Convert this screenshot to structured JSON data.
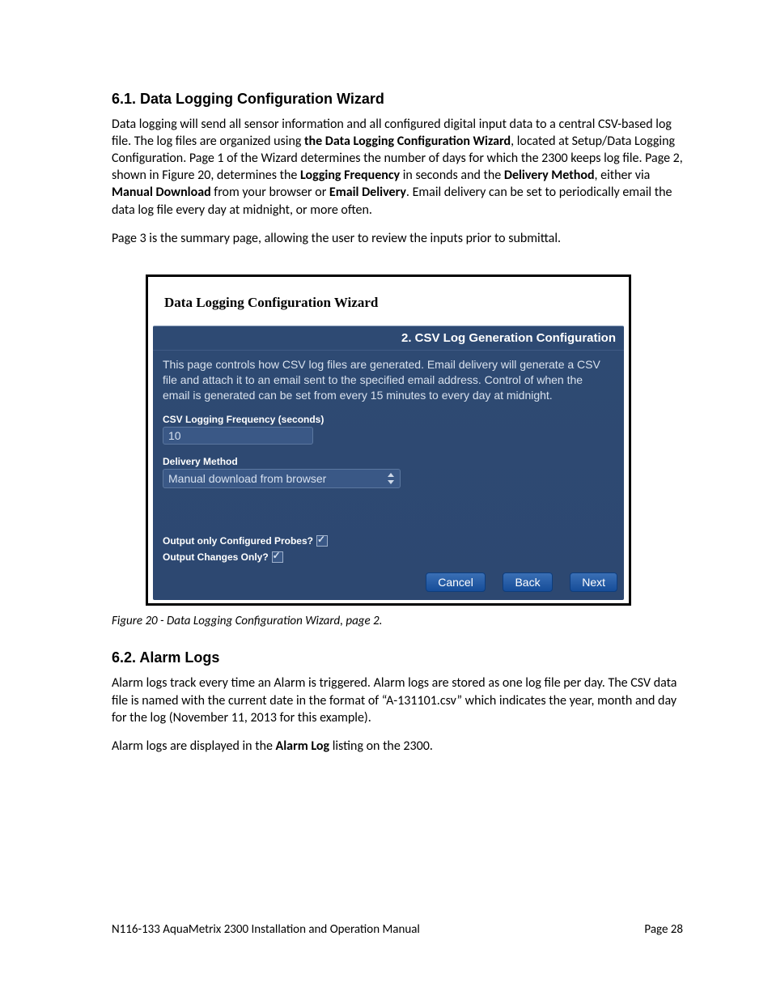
{
  "section61": {
    "heading": "6.1. Data Logging Configuration Wizard",
    "p1a": "Data logging will send all sensor information and all configured digital input data to a central CSV-based log file. The log files are organized using ",
    "p1b_bold": "the Data Logging Configuration Wizard",
    "p1c": ", located at Setup/Data Logging Configuration.  Page 1 of the Wizard determines the number of days for which the 2300 keeps log file.  Page 2, shown in Figure 20, determines the ",
    "p1d_bold": "Logging Frequency",
    "p1e": " in seconds and the ",
    "p1f_bold": "Delivery Method",
    "p1g": ", either via ",
    "p1h_bold": "Manual Download",
    "p1i": " from your browser or ",
    "p1j_bold": "Email Delivery",
    "p1k": ".  Email delivery can be set to periodically email the data log file every day at midnight, or more often.",
    "p2": "Page 3 is the summary page, allowing the user to review the inputs prior to submittal."
  },
  "wizard": {
    "title": "Data Logging Configuration Wizard",
    "panel_header": "2. CSV Log Generation Configuration",
    "description": "This page controls how CSV log files are generated. Email delivery will generate a CSV file and attach it to an email sent to the specified email address. Control of when the email is generated can be set from every 15 minutes to every day at midnight.",
    "freq_label": "CSV Logging Frequency (seconds)",
    "freq_value": "10",
    "delivery_label": "Delivery Method",
    "delivery_value": "Manual download from browser",
    "check1": "Output only Configured Probes?",
    "check2": "Output Changes Only?",
    "btn_cancel": "Cancel",
    "btn_back": "Back",
    "btn_next": "Next"
  },
  "caption": "Figure 20 - Data Logging Configuration Wizard, page 2.",
  "section62": {
    "heading": "6.2. Alarm Logs",
    "p1": "Alarm logs track every time an Alarm is triggered. Alarm logs are stored as one log file per day. The CSV data file is named with the current date in the format of “A-131101.csv” which indicates the year, month and day for the log (November 11, 2013 for this example).",
    "p2a": "Alarm logs are displayed in the ",
    "p2b_bold": "Alarm Log",
    "p2c": " listing on the 2300."
  },
  "footer": {
    "left": "N116-133 AquaMetrix 2300 Installation and Operation Manual",
    "right": "Page 28"
  }
}
